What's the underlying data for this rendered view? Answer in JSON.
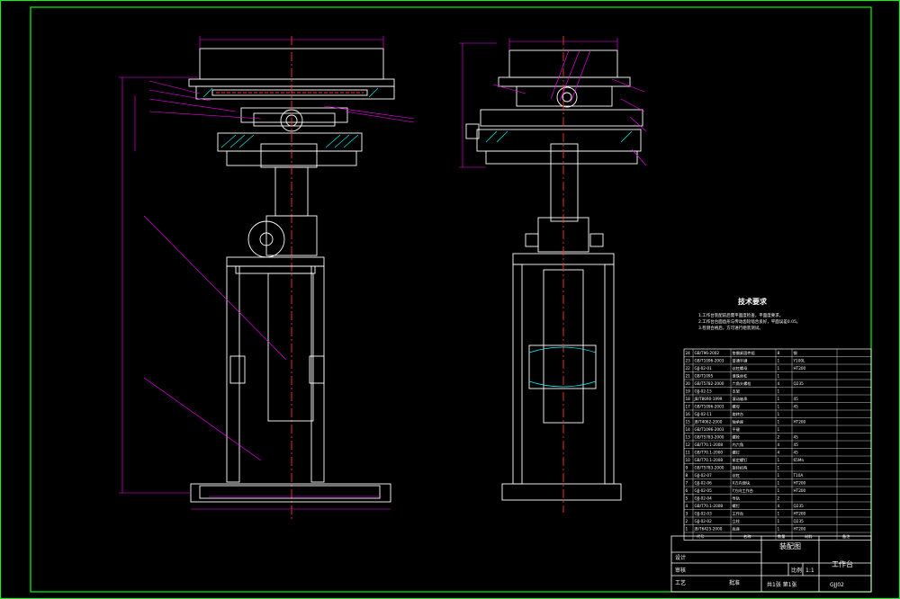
{
  "drawing": {
    "colors": {
      "background": "#000000",
      "frame": "#00ff00",
      "outline": "#ffffff",
      "dimension": "#ff00ff",
      "centerline": "#ff3030",
      "hatch": "#00ffff",
      "leader": "#ff00ff"
    }
  },
  "technical_requirements": {
    "title": "技术要求",
    "lines": [
      "1.工作台装配前后需平面度检查，平面度要求。",
      "2.工作台台面齿形与传动齿轮啮合良好，平面误差0.05。",
      "3.检测合格后，方可进行组装测试。"
    ]
  },
  "bom": {
    "rows": [
      [
        "24",
        "GB/T96-2002",
        "垫圈紧固件组",
        "8",
        "钢",
        ""
      ],
      [
        "23",
        "GB/T1096-2003",
        "普通平键",
        "1",
        "Y100L",
        ""
      ],
      [
        "22",
        "GJJ-02-01",
        "丝杠螺母",
        "1",
        "HT200",
        ""
      ],
      [
        "21",
        "GB/T1095",
        "滚珠丝杠",
        "1",
        "",
        ""
      ],
      [
        "20",
        "GB/T5782-2000",
        "六角头螺栓",
        "4",
        "Q235",
        ""
      ],
      [
        "19",
        "GJJ-02-15",
        "支架",
        "1",
        "",
        ""
      ],
      [
        "18",
        "JB/T8690-1999",
        "滚动轴承",
        "1",
        "45",
        ""
      ],
      [
        "17",
        "GB/T1096-2003",
        "螺母",
        "1",
        "45",
        ""
      ],
      [
        "16",
        "GJJ-02-11",
        "旋转台",
        "1",
        "",
        ""
      ],
      [
        "15",
        "JB/T4062-2000",
        "轴承座",
        "1",
        "HT200",
        ""
      ],
      [
        "14",
        "GB/T1096-2003",
        "平键",
        "1",
        "",
        ""
      ],
      [
        "13",
        "GB/T5783-2000",
        "螺栓",
        "2",
        "45",
        ""
      ],
      [
        "12",
        "GB/T70.1-2008",
        "内六角",
        "4",
        "45",
        ""
      ],
      [
        "11",
        "GB/T70.1-2000",
        "螺钉",
        "4",
        "45",
        ""
      ],
      [
        "10",
        "GB/T70.1-2008",
        "紧定螺钉",
        "1",
        "65Mn",
        ""
      ],
      [
        "9",
        "GB/T5783-2000",
        "旋转机构",
        "1",
        "",
        ""
      ],
      [
        "8",
        "GJJ-02-07",
        "丝杠",
        "1",
        "T10A",
        ""
      ],
      [
        "7",
        "GJJ-02-06",
        "X方向滑块",
        "1",
        "HT200",
        ""
      ],
      [
        "6",
        "GJJ-02-05",
        "Y方向工作台",
        "1",
        "HT200",
        ""
      ],
      [
        "5",
        "GJJ-02-04",
        "导轨",
        "2",
        "",
        ""
      ],
      [
        "4",
        "GB/T70.1-2008",
        "螺钉",
        "4",
        "Q235",
        ""
      ],
      [
        "3",
        "GJJ-02-03",
        "工作台",
        "1",
        "HT200",
        ""
      ],
      [
        "2",
        "GJJ-02-02",
        "立柱",
        "1",
        "Q235",
        ""
      ],
      [
        "1",
        "JB/T6425-2000",
        "底座",
        "1",
        "HT200",
        ""
      ]
    ],
    "header": [
      "代号",
      "名称",
      "数量",
      "材料",
      "备注"
    ]
  },
  "title_block": {
    "drawing_name": "装配图",
    "part_name": "工作台",
    "drawing_number": "GJJ02",
    "scale_label": "比例",
    "scale": "1:1",
    "sheet": "共1张 第1张",
    "designer_label": "设计",
    "checker_label": "审核",
    "process_label": "工艺",
    "approve_label": "批准"
  }
}
